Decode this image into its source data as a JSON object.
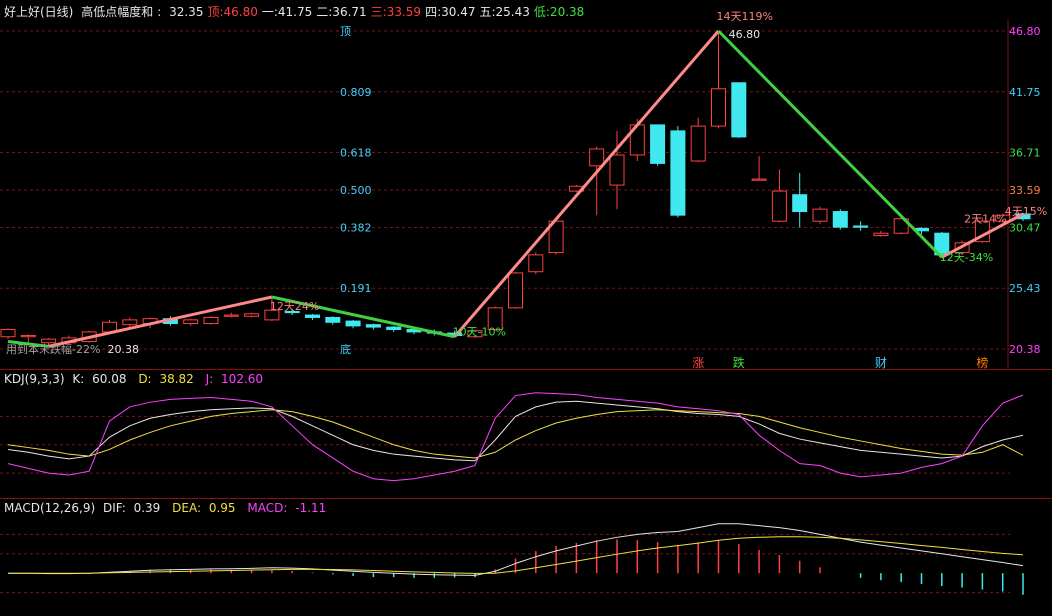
{
  "main_panel": {
    "title": "好上好(日线)",
    "indicator_name": "高低点幅度和",
    "values": [
      {
        "label": "",
        "value": "32.35",
        "color": "#e6e6e6"
      },
      {
        "label": "顶",
        "value": "46.80",
        "color": "#ff4040"
      },
      {
        "label": "一",
        "value": "41.75",
        "color": "#e6e6e6"
      },
      {
        "label": "二",
        "value": "36.71",
        "color": "#e6e6e6"
      },
      {
        "label": "三",
        "value": "33.59",
        "color": "#ff4040"
      },
      {
        "label": "四",
        "value": "30.47",
        "color": "#e6e6e6"
      },
      {
        "label": "五",
        "value": "25.43",
        "color": "#e6e6e6"
      },
      {
        "label": "低",
        "value": "20.38",
        "color": "#40e040"
      }
    ],
    "price_axis": [
      {
        "price": 46.8,
        "label": "46.80",
        "fib": "顶",
        "color": "#ff40ff"
      },
      {
        "price": 41.75,
        "label": "41.75",
        "fib": "0.809",
        "color": "#40d0ff"
      },
      {
        "price": 36.71,
        "label": "36.71",
        "fib": "0.618",
        "color": "#40e040"
      },
      {
        "price": 33.59,
        "label": "33.59",
        "fib": "0.500",
        "color": "#ff8040"
      },
      {
        "price": 30.47,
        "label": "30.47",
        "fib": "0.382",
        "color": "#40e040"
      },
      {
        "price": 25.43,
        "label": "25.43",
        "fib": "0.191",
        "color": "#40d0ff"
      },
      {
        "price": 20.38,
        "label": "20.38",
        "fib": "底",
        "color": "#ff40ff"
      }
    ],
    "annotations": [
      {
        "text": "12天24%",
        "idx": 13,
        "price": 23.6,
        "color": "#ff8080"
      },
      {
        "text": "10天-10%",
        "idx": 22,
        "price": 21.5,
        "color": "#40e040"
      },
      {
        "text": "14天119%",
        "idx": 35,
        "price": 47.7,
        "color": "#ff8080"
      },
      {
        "text": "46.80",
        "idx": 35.6,
        "price": 46.2,
        "color": "#e6e6e6"
      },
      {
        "text": "12天-34%",
        "idx": 46,
        "price": 27.7,
        "color": "#40e040"
      },
      {
        "text": "2天14%",
        "idx": 47.2,
        "price": 30.9,
        "color": "#ff8080"
      },
      {
        "text": "4天15%",
        "idx": 49.2,
        "price": 31.5,
        "color": "#ff8080"
      },
      {
        "text": "用到本末跌幅-22%",
        "idx": 0,
        "price": 20.05,
        "color": "#a0a0a0"
      },
      {
        "text": "20.38",
        "idx": 5,
        "price": 20.05,
        "color": "#e6e6e6"
      }
    ],
    "event_markers": [
      {
        "text": "涨",
        "idx": 34,
        "color": "#ff4040"
      },
      {
        "text": "跌",
        "idx": 36,
        "color": "#40e040"
      },
      {
        "text": "财",
        "idx": 43,
        "color": "#40d0ff"
      },
      {
        "text": "榜",
        "idx": 48,
        "color": "#ff8000"
      }
    ]
  },
  "kdj_panel": {
    "title": "KDJ(9,3,3)",
    "k": {
      "label": "K:",
      "value": "60.08",
      "color": "#e6e6e6"
    },
    "d": {
      "label": "D:",
      "value": "38.82",
      "color": "#f0e040"
    },
    "j": {
      "label": "J:",
      "value": "102.60",
      "color": "#ff40ff"
    }
  },
  "macd_panel": {
    "title": "MACD(12,26,9)",
    "dif": {
      "label": "DIF:",
      "value": "0.39",
      "color": "#e6e6e6"
    },
    "dea": {
      "label": "DEA:",
      "value": "0.95",
      "color": "#f0e040"
    },
    "macd": {
      "label": "MACD:",
      "value": "-1.11",
      "color": "#ff40ff"
    }
  },
  "chart_data": {
    "type": "candlestick",
    "y_range": [
      20.38,
      46.8
    ],
    "candles": [
      [
        21.4,
        22.0,
        21.2,
        22.1
      ],
      [
        21.4,
        21.5,
        20.9,
        21.6
      ],
      [
        20.9,
        21.2,
        20.7,
        21.3
      ],
      [
        20.9,
        21.3,
        20.8,
        21.5
      ],
      [
        21.0,
        21.8,
        20.9,
        21.9
      ],
      [
        21.8,
        22.6,
        21.6,
        22.8
      ],
      [
        22.4,
        22.8,
        22.0,
        23.0
      ],
      [
        22.5,
        22.9,
        22.1,
        23.0
      ],
      [
        22.9,
        22.5,
        22.3,
        23.1
      ],
      [
        22.5,
        22.8,
        22.3,
        22.9
      ],
      [
        22.5,
        23.0,
        22.4,
        23.1
      ],
      [
        23.1,
        23.2,
        23.0,
        23.4
      ],
      [
        23.1,
        23.3,
        23.0,
        23.4
      ],
      [
        22.8,
        23.6,
        22.7,
        24.7
      ],
      [
        23.5,
        23.4,
        23.2,
        23.7
      ],
      [
        23.2,
        23.0,
        22.8,
        23.3
      ],
      [
        23.0,
        22.6,
        22.4,
        23.1
      ],
      [
        22.7,
        22.3,
        22.1,
        22.8
      ],
      [
        22.4,
        22.2,
        22.0,
        22.5
      ],
      [
        22.2,
        22.0,
        21.8,
        22.3
      ],
      [
        22.0,
        21.8,
        21.6,
        22.1
      ],
      [
        21.8,
        21.7,
        21.5,
        22.0
      ],
      [
        21.7,
        21.5,
        21.4,
        21.9
      ],
      [
        21.4,
        21.9,
        21.3,
        22.0
      ],
      [
        22.0,
        23.8,
        21.9,
        23.9
      ],
      [
        23.8,
        26.7,
        23.7,
        26.8
      ],
      [
        26.8,
        28.2,
        26.6,
        28.4
      ],
      [
        28.4,
        31.0,
        28.2,
        31.2
      ],
      [
        33.5,
        33.9,
        33.4,
        34.0
      ],
      [
        35.6,
        37.0,
        31.5,
        37.2
      ],
      [
        34.0,
        36.5,
        32.0,
        38.5
      ],
      [
        36.5,
        39.0,
        36.0,
        39.5
      ],
      [
        39.0,
        35.8,
        35.6,
        39.0
      ],
      [
        38.5,
        31.5,
        31.3,
        38.9
      ],
      [
        36.0,
        38.9,
        35.9,
        39.6
      ],
      [
        38.9,
        42.0,
        38.7,
        46.8
      ],
      [
        42.5,
        38.0,
        37.9,
        42.5
      ],
      [
        34.4,
        34.5,
        34.4,
        36.4
      ],
      [
        31.0,
        33.5,
        30.9,
        35.3
      ],
      [
        33.2,
        31.8,
        30.5,
        35.0
      ],
      [
        31.0,
        32.0,
        30.8,
        32.2
      ],
      [
        31.8,
        30.5,
        30.3,
        32.0
      ],
      [
        30.6,
        30.5,
        30.2,
        31.0
      ],
      [
        29.8,
        30.0,
        29.7,
        30.2
      ],
      [
        30.0,
        31.2,
        29.9,
        31.3
      ],
      [
        30.4,
        30.2,
        29.9,
        30.5
      ],
      [
        30.0,
        28.2,
        28.0,
        30.1
      ],
      [
        28.4,
        29.2,
        28.2,
        29.4
      ],
      [
        29.3,
        31.0,
        29.2,
        31.3
      ],
      [
        31.0,
        31.5,
        30.9,
        31.6
      ],
      [
        31.6,
        31.2,
        31.0,
        31.7
      ]
    ],
    "zigzag": [
      {
        "idx": 0,
        "price": 21.0
      },
      {
        "idx": 2,
        "price": 20.6
      },
      {
        "idx": 13,
        "price": 24.7
      },
      {
        "idx": 22,
        "price": 21.4
      },
      {
        "idx": 35,
        "price": 46.8
      },
      {
        "idx": 46,
        "price": 28.0
      },
      {
        "idx": 50,
        "price": 31.6
      }
    ],
    "kdj_range": [
      0,
      110
    ],
    "k": [
      45,
      42,
      38,
      35,
      38,
      58,
      70,
      78,
      82,
      85,
      87,
      88,
      89,
      88,
      80,
      70,
      60,
      50,
      44,
      40,
      38,
      36,
      34,
      33,
      55,
      80,
      90,
      95,
      96,
      94,
      92,
      90,
      88,
      85,
      83,
      82,
      80,
      72,
      62,
      56,
      52,
      48,
      44,
      42,
      40,
      38,
      36,
      38,
      48,
      55,
      60
    ],
    "d": [
      50,
      47,
      44,
      40,
      38,
      45,
      55,
      63,
      70,
      75,
      80,
      83,
      85,
      87,
      85,
      80,
      74,
      66,
      58,
      50,
      44,
      40,
      38,
      36,
      42,
      55,
      65,
      73,
      78,
      82,
      85,
      86,
      87,
      86,
      85,
      84,
      83,
      80,
      74,
      68,
      63,
      58,
      54,
      50,
      46,
      43,
      40,
      39,
      42,
      50,
      38.8
    ],
    "j": [
      30,
      25,
      20,
      18,
      22,
      75,
      90,
      95,
      98,
      99,
      100,
      98,
      96,
      90,
      70,
      50,
      36,
      22,
      14,
      12,
      14,
      18,
      22,
      28,
      78,
      102,
      105,
      104,
      103,
      100,
      98,
      96,
      94,
      90,
      88,
      86,
      82,
      60,
      44,
      30,
      28,
      20,
      16,
      18,
      20,
      26,
      30,
      38,
      70,
      94,
      102.6
    ],
    "macd_range": [
      -2.0,
      3.0
    ],
    "dif": [
      0.0,
      0.0,
      -0.02,
      -0.02,
      0.0,
      0.05,
      0.1,
      0.15,
      0.18,
      0.2,
      0.22,
      0.23,
      0.25,
      0.28,
      0.26,
      0.22,
      0.16,
      0.1,
      0.04,
      0.0,
      -0.05,
      -0.08,
      -0.1,
      -0.11,
      0.1,
      0.5,
      0.85,
      1.15,
      1.4,
      1.65,
      1.85,
      2.0,
      2.1,
      2.15,
      2.35,
      2.55,
      2.55,
      2.45,
      2.35,
      2.2,
      2.0,
      1.8,
      1.6,
      1.45,
      1.3,
      1.15,
      1.0,
      0.85,
      0.7,
      0.55,
      0.39
    ],
    "dea": [
      0.0,
      0.0,
      0.0,
      0.0,
      0.0,
      0.02,
      0.04,
      0.06,
      0.08,
      0.1,
      0.12,
      0.14,
      0.16,
      0.18,
      0.2,
      0.2,
      0.19,
      0.17,
      0.14,
      0.1,
      0.07,
      0.04,
      0.01,
      -0.01,
      0.0,
      0.12,
      0.28,
      0.45,
      0.62,
      0.8,
      0.98,
      1.15,
      1.3,
      1.42,
      1.55,
      1.7,
      1.8,
      1.85,
      1.88,
      1.88,
      1.85,
      1.8,
      1.72,
      1.63,
      1.53,
      1.43,
      1.33,
      1.22,
      1.12,
      1.02,
      0.95
    ],
    "macd": [
      0.0,
      0.0,
      -0.04,
      -0.04,
      0.0,
      0.06,
      0.12,
      0.18,
      0.2,
      0.2,
      0.2,
      0.18,
      0.18,
      0.2,
      0.12,
      0.04,
      -0.06,
      -0.14,
      -0.2,
      -0.2,
      -0.24,
      -0.24,
      -0.22,
      -0.2,
      0.2,
      0.76,
      1.14,
      1.4,
      1.56,
      1.7,
      1.74,
      1.7,
      1.6,
      1.46,
      1.6,
      1.7,
      1.5,
      1.2,
      0.94,
      0.64,
      0.3,
      0.0,
      -0.24,
      -0.36,
      -0.46,
      -0.56,
      -0.66,
      -0.74,
      -0.84,
      -0.94,
      -1.11
    ]
  }
}
